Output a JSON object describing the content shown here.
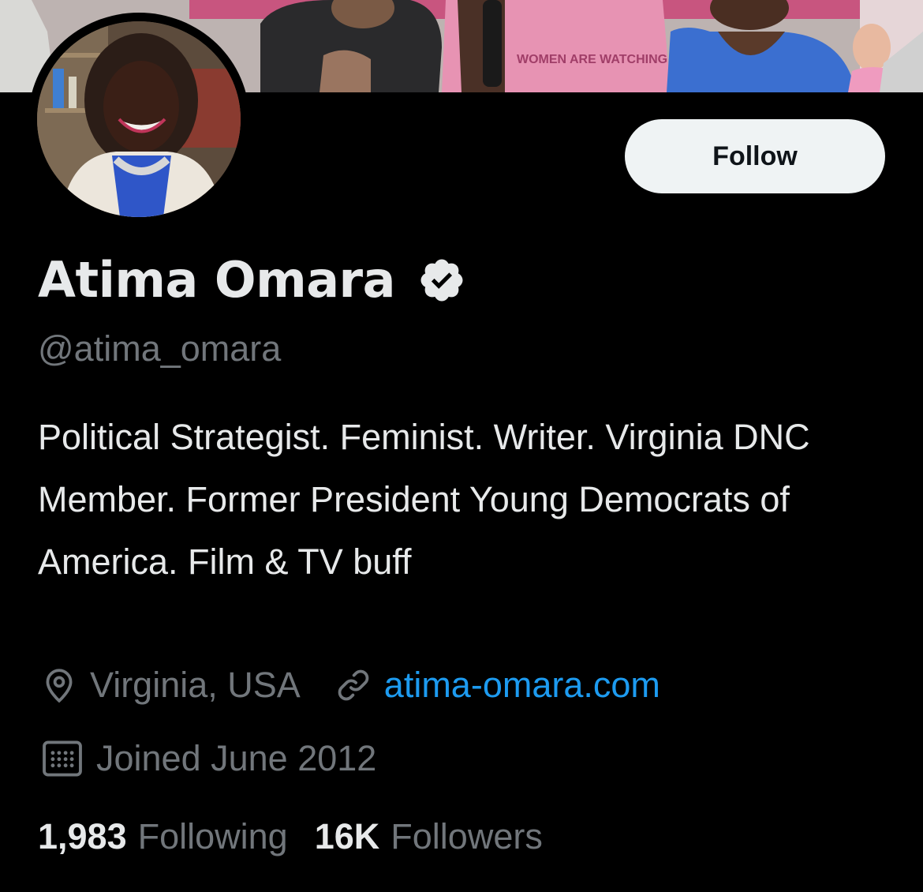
{
  "profile": {
    "display_name": "Atima Omara",
    "handle": "@atima_omara",
    "bio": "Political Strategist. Feminist. Writer. Virginia DNC Member. Former President Young Democrats of America. Film & TV buff",
    "location": "Virginia, USA",
    "website": "atima-omara.com",
    "joined": "Joined June 2012",
    "verified_icon": "verified-badge-icon"
  },
  "banner": {
    "sign_text": "WOMEN ARE WATCHING"
  },
  "actions": {
    "follow_label": "Follow"
  },
  "stats": {
    "following_count": "1,983",
    "following_label": "Following",
    "followers_count": "16K",
    "followers_label": "Followers"
  },
  "icons": {
    "location": "map-pin-icon",
    "website": "link-icon",
    "joined": "calendar-icon"
  },
  "colors": {
    "background": "#000000",
    "primary_text": "#e7e9ea",
    "secondary_text": "#71767b",
    "link": "#1d9bf0",
    "button_bg": "#eff3f4",
    "button_text": "#0f1419"
  }
}
